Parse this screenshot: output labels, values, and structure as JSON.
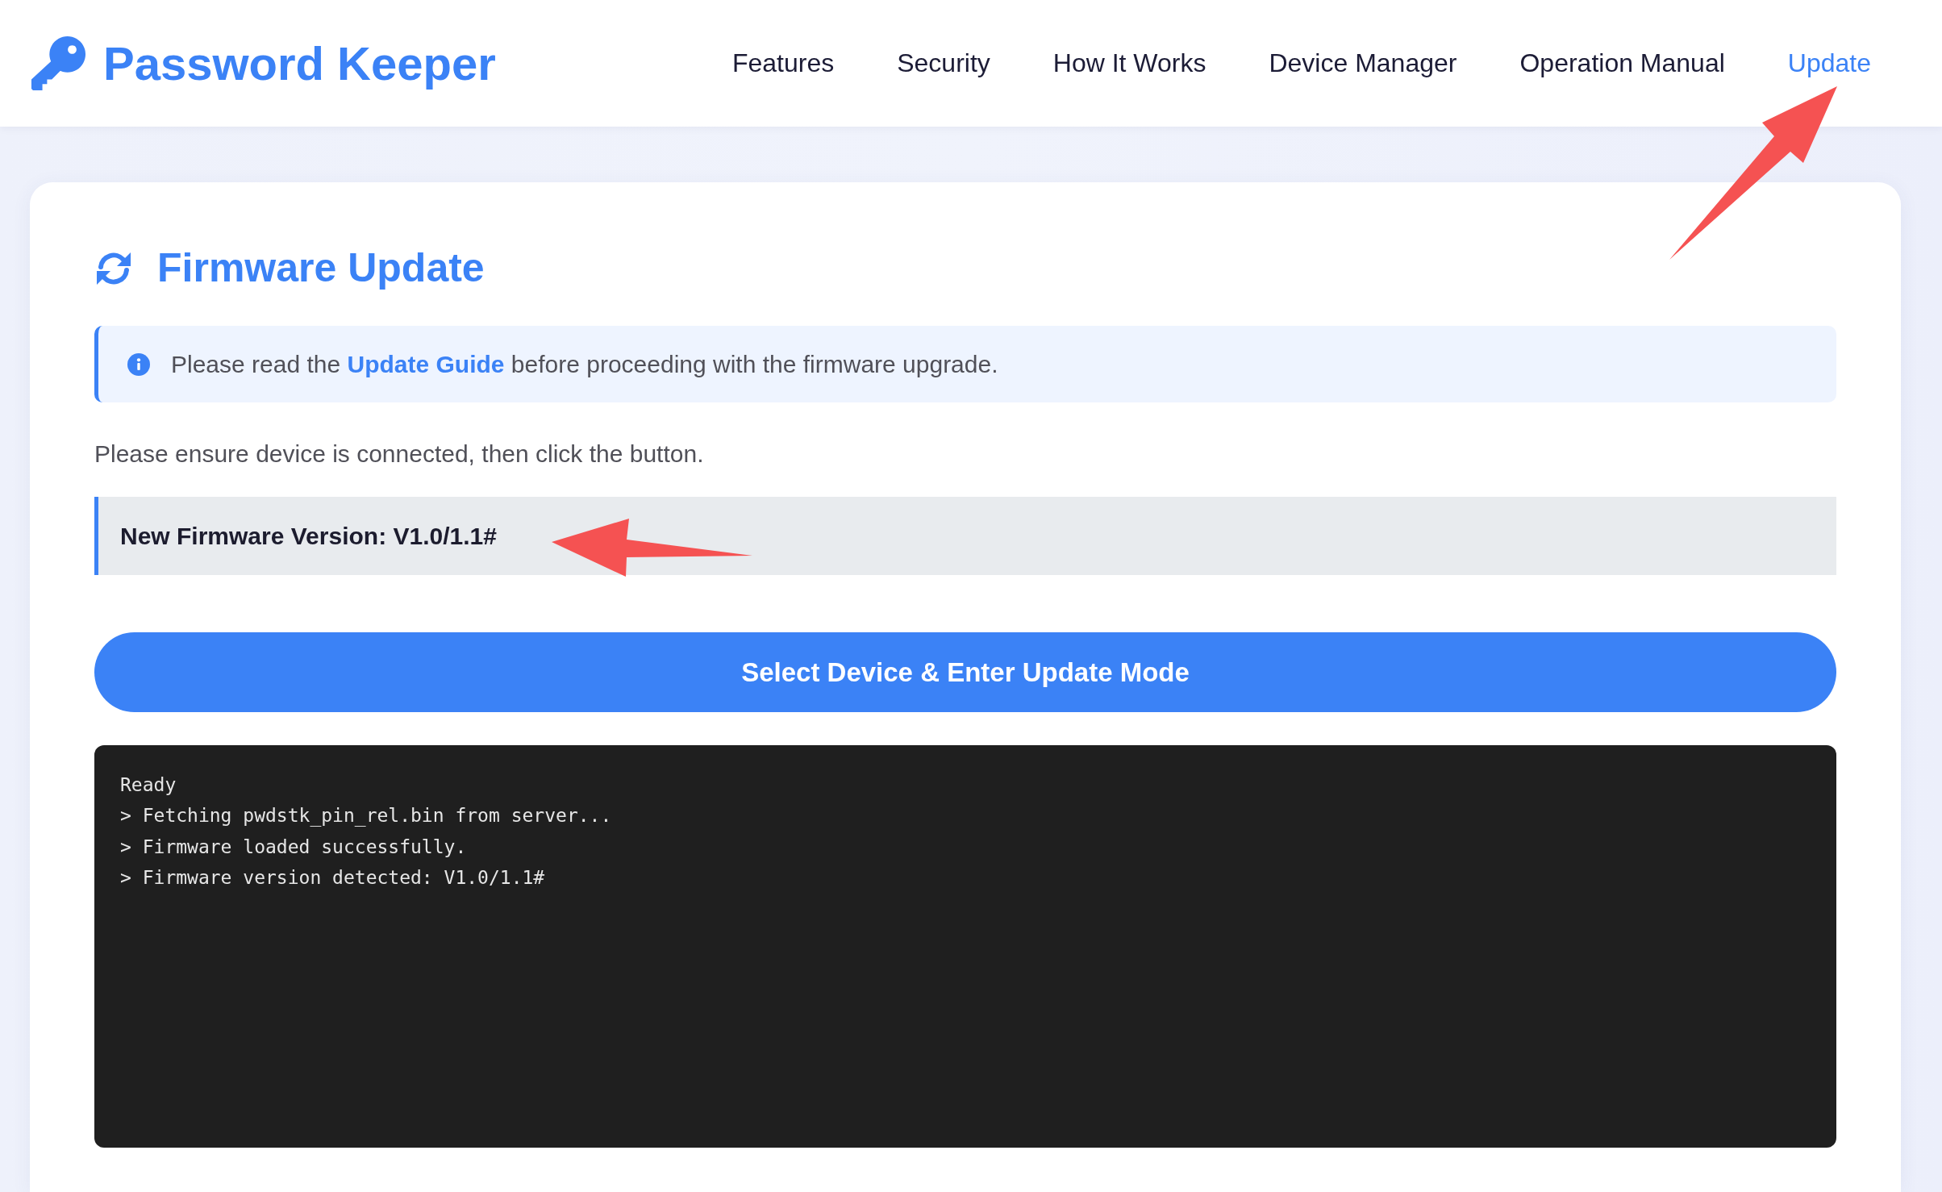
{
  "header": {
    "logo": {
      "title": "Password Keeper"
    },
    "nav": [
      {
        "label": "Features",
        "selected": false
      },
      {
        "label": "Security",
        "selected": false
      },
      {
        "label": "How It Works",
        "selected": false
      },
      {
        "label": "Device Manager",
        "selected": false
      },
      {
        "label": "Operation Manual",
        "selected": false
      },
      {
        "label": "Update",
        "selected": true
      }
    ]
  },
  "update_card": {
    "title": "Firmware Update",
    "notice": {
      "before": "Please read the",
      "link": "Update Guide",
      "after": "before proceeding with the firmware upgrade."
    },
    "instruction": "Please ensure device is connected, then click the button.",
    "version_banner": "New Firmware Version: V1.0/1.1#",
    "button": "Select Device & Enter Update Mode",
    "console": {
      "lines": [
        "Ready",
        "> Fetching pwdstk_pin_rel.bin from server...",
        "> Firmware loaded successfully.",
        "> Firmware version detected: V1.0/1.1#"
      ]
    }
  }
}
